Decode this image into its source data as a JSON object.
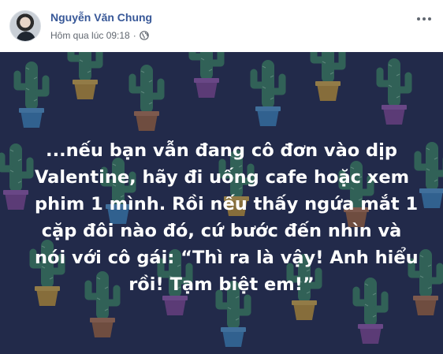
{
  "post": {
    "author": "Nguyễn Văn Chung",
    "timestamp": "Hôm qua lúc 09:18",
    "separator": "·",
    "privacy_icon": "globe-icon",
    "more_icon": "more-options-icon"
  },
  "image": {
    "pattern": "cactus-pot-pattern",
    "text_lines": [
      "...nếu bạn vẫn đang cô đơn vào dịp",
      "Valentine, hãy đi uống cafe hoặc xem",
      "phim 1 mình. Rồi nếu thấy ngứa mắt 1",
      "cặp đôi nào đó, cứ bước đến nhìn và",
      "nói với cô gái: “Thì ra là vậy! Anh hiểu",
      "rồi! Tạm biệt em!”"
    ]
  },
  "colors": {
    "author_name": "#385898",
    "meta_text": "#616770",
    "image_background": "#222a4a",
    "image_text": "#ffffff"
  }
}
